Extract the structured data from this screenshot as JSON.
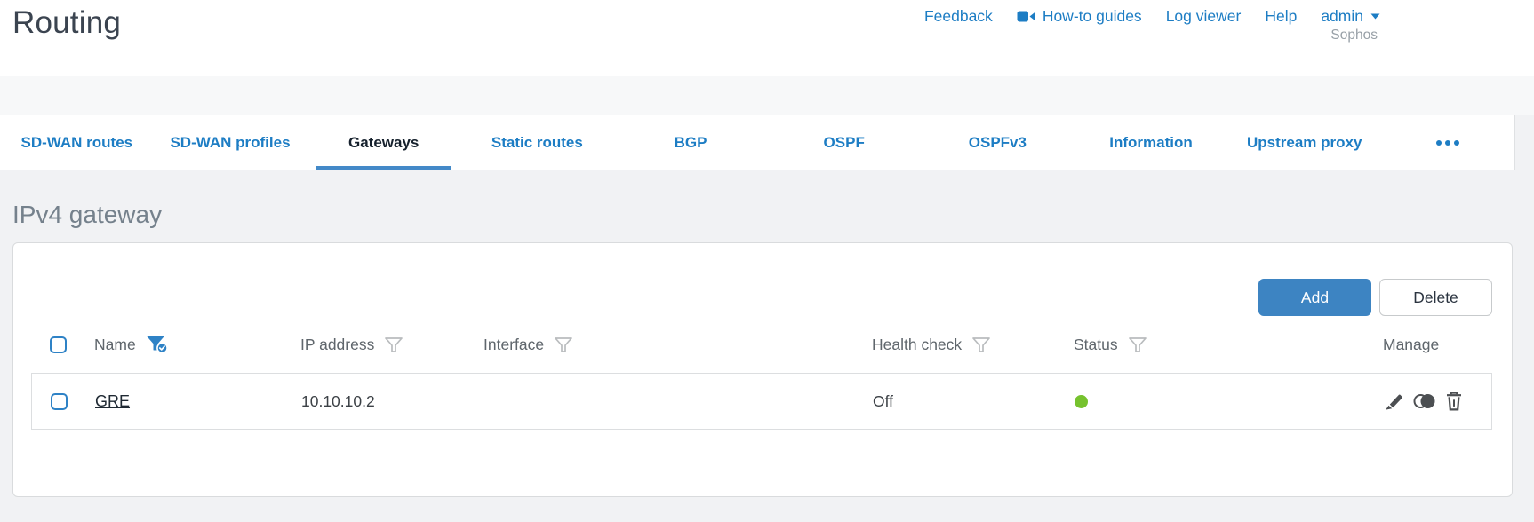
{
  "page": {
    "title": "Routing",
    "brand": "Sophos"
  },
  "header": {
    "links": [
      {
        "label": "Feedback"
      },
      {
        "label": "How-to guides",
        "icon": "video-camera-icon"
      },
      {
        "label": "Log viewer"
      },
      {
        "label": "Help"
      },
      {
        "label": "admin",
        "icon": "caret-down-icon"
      }
    ]
  },
  "tabs": {
    "active": "Gateways",
    "items": [
      {
        "label": "SD-WAN routes"
      },
      {
        "label": "SD-WAN profiles"
      },
      {
        "label": "Gateways"
      },
      {
        "label": "Static routes"
      },
      {
        "label": "BGP"
      },
      {
        "label": "OSPF"
      },
      {
        "label": "OSPFv3"
      },
      {
        "label": "Information"
      },
      {
        "label": "Upstream proxy"
      }
    ],
    "overflow_icon": "ellipsis-icon"
  },
  "section": {
    "heading": "IPv4 gateway"
  },
  "toolbar": {
    "add_label": "Add",
    "delete_label": "Delete"
  },
  "table": {
    "columns": [
      {
        "label": "Name",
        "filter": "active"
      },
      {
        "label": "IP address",
        "filter": "default"
      },
      {
        "label": "Interface",
        "filter": "default"
      },
      {
        "label": "Health check",
        "filter": "default"
      },
      {
        "label": "Status",
        "filter": "default"
      },
      {
        "label": "Manage",
        "filter": "none"
      }
    ],
    "rows": [
      {
        "name": "GRE",
        "ip_address": "10.10.10.2",
        "interface": "",
        "health_check": "Off",
        "status": "up",
        "manage_icons": [
          "edit-icon",
          "clone-icon",
          "delete-icon"
        ]
      }
    ]
  },
  "colors": {
    "link_blue": "#1d7dc4",
    "active_tab_underline": "#4389c8",
    "add_button_bg": "#3d84c2",
    "status_green": "#76c22e",
    "content_background": "#f1f2f4"
  }
}
